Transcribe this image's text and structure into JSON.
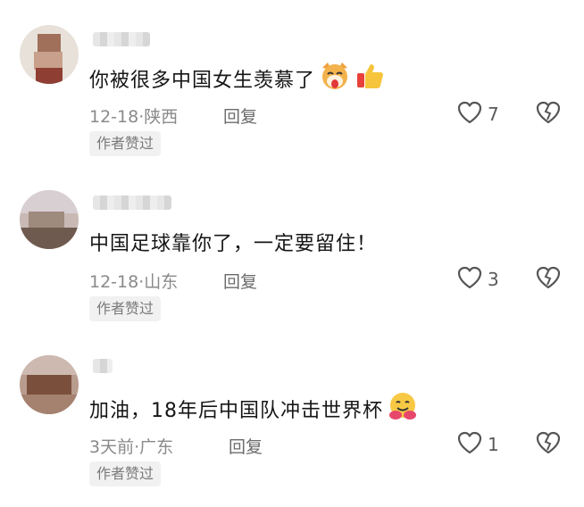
{
  "comments": [
    {
      "text": "你被很多中国女生羡慕了",
      "emojis": [
        "dog-emoji",
        "thumbs-up-emoji"
      ],
      "date": "12-18",
      "location": "陕西",
      "reply_label": "回复",
      "likes": "7",
      "badge": "作者赞过"
    },
    {
      "text": "中国足球靠你了，一定要留住！",
      "emojis": [],
      "date": "12-18",
      "location": "山东",
      "reply_label": "回复",
      "likes": "3",
      "badge": "作者赞过"
    },
    {
      "text": "加油，18年后中国队冲击世界杯",
      "emojis": [
        "hugging-emoji"
      ],
      "date": "3天前",
      "location": "广东",
      "reply_label": "回复",
      "likes": "1",
      "badge": "作者赞过"
    }
  ],
  "colors": {
    "text": "#161616",
    "meta": "#8a8a8a",
    "badge_bg": "#f1f1f1"
  }
}
